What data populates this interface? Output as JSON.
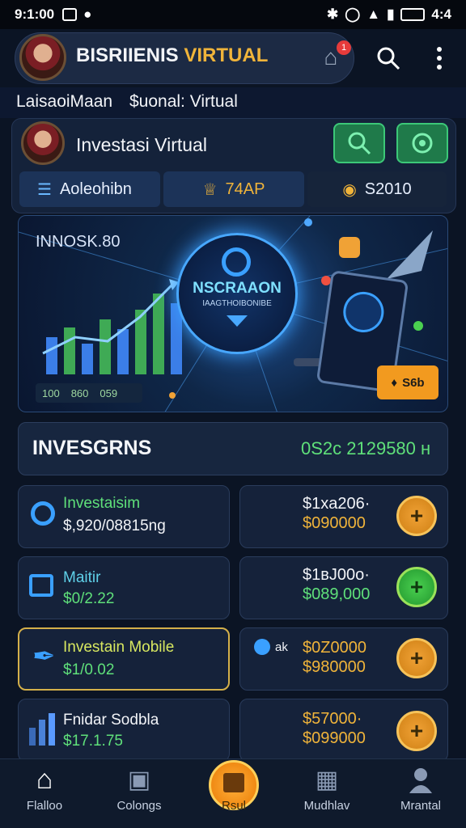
{
  "status_bar": {
    "time": "9:1:00",
    "battery": "4:4"
  },
  "header": {
    "title_main": "BISRIIENIS",
    "title_accent": "VIRTUAL",
    "notif_count": "1"
  },
  "sub_tabs": {
    "left": "LaisaoiMaan",
    "right": "$uonal: Virtual"
  },
  "profile": {
    "title": "Investasi Virtual",
    "chip1": "Aoleohibn",
    "chip2": "74AP",
    "chip3": "S2010"
  },
  "hero": {
    "title": "INNOSK.80",
    "orb_title": "NSCRAAON",
    "orb_sub": "IAAGTHOIBONIBE",
    "stats": [
      "100",
      "860",
      "059"
    ],
    "button_label": "S6b"
  },
  "investments": {
    "title": "INVESGRNS",
    "total": "0S2c 2129580 н"
  },
  "rows": [
    {
      "name": "Investaisim",
      "amount": "$,920/08815ng",
      "price1": "$1хa206·",
      "price2": "$090000",
      "button": "gold",
      "name_color": "#5fe07a",
      "amount_color": "#f2f4f8",
      "icon": "gear-icon"
    },
    {
      "name": "Maitir",
      "amount": "$0/2.22",
      "price1": "$1вJ00o·",
      "price2": "$089,000",
      "button": "green",
      "name_color": "#5fd0e8",
      "amount_color": "#5fe07a",
      "icon": "monitor-icon"
    },
    {
      "name": "Investain Mobile",
      "amount": "$1/0.02",
      "price1": "$0Z0000",
      "price2": "$980000",
      "button": "gold",
      "name_color": "#d8e860",
      "amount_color": "#5fe07a",
      "icon": "pen-icon",
      "extra": "ak",
      "active": true
    },
    {
      "name": "Fnidar Sodbla",
      "amount": "$17.1.75",
      "price1": "$57000·",
      "price2": "$099000",
      "button": "gold",
      "name_color": "#f2f4f8",
      "amount_color": "#5fe07a",
      "icon": "bar-chart-icon"
    }
  ],
  "plus_symbol": "+",
  "nav": [
    "Flalloo",
    "Colongs",
    "Rsul",
    "Mudhlav",
    "Mrantal"
  ]
}
